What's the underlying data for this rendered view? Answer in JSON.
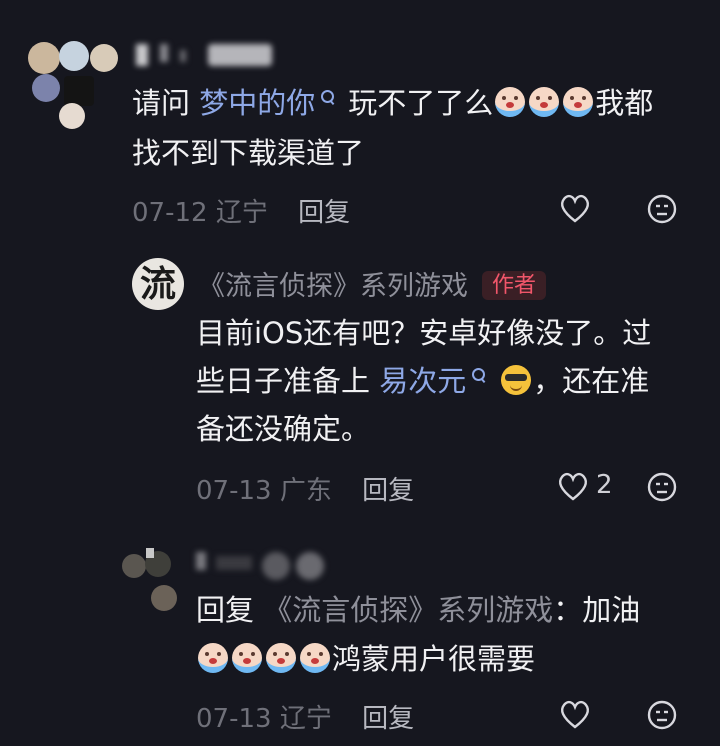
{
  "comments": [
    {
      "text_prefix": "请问 ",
      "mention": "梦中的你",
      "text_after_mention": "玩不了了么",
      "text_tail": "我都",
      "line2": "找不到下载渠道了",
      "date": "07-12",
      "location": "辽宁",
      "reply_label": "回复",
      "emoji": "crying-emoji"
    },
    {
      "author": "《流言侦探》系列游戏",
      "author_badge": "作者",
      "avatar_char": "流",
      "line1": "目前iOS还有吧？安卓好像没了。过",
      "line2_prefix": "些日子准备上 ",
      "mention": "易次元",
      "line2_suffix": "，还在准",
      "line3": "备还没确定。",
      "date": "07-13",
      "location": "广东",
      "reply_label": "回复",
      "like_count": "2",
      "emoji": "cool-emoji"
    },
    {
      "reply_prefix": "回复 ",
      "reply_to": "《流言侦探》系列游戏",
      "reply_colon": "：加油",
      "line2_text": "鸿蒙用户很需要",
      "date": "07-13",
      "location": "辽宁",
      "reply_label": "回复",
      "emoji": "crying-emoji"
    }
  ],
  "colors": {
    "background": "#16171f",
    "link": "#8ea8e6",
    "author_badge_bg": "#3a1f25",
    "author_badge_text": "#f1566a",
    "meta": "#6f7079"
  }
}
